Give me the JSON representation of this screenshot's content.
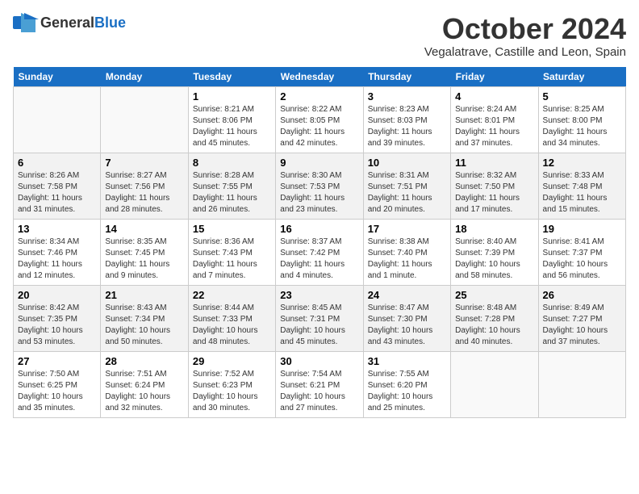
{
  "header": {
    "logo_general": "General",
    "logo_blue": "Blue",
    "month_title": "October 2024",
    "location": "Vegalatrave, Castille and Leon, Spain"
  },
  "weekdays": [
    "Sunday",
    "Monday",
    "Tuesday",
    "Wednesday",
    "Thursday",
    "Friday",
    "Saturday"
  ],
  "weeks": [
    [
      {
        "day": "",
        "sunrise": "",
        "sunset": "",
        "daylight": ""
      },
      {
        "day": "",
        "sunrise": "",
        "sunset": "",
        "daylight": ""
      },
      {
        "day": "1",
        "sunrise": "Sunrise: 8:21 AM",
        "sunset": "Sunset: 8:06 PM",
        "daylight": "Daylight: 11 hours and 45 minutes."
      },
      {
        "day": "2",
        "sunrise": "Sunrise: 8:22 AM",
        "sunset": "Sunset: 8:05 PM",
        "daylight": "Daylight: 11 hours and 42 minutes."
      },
      {
        "day": "3",
        "sunrise": "Sunrise: 8:23 AM",
        "sunset": "Sunset: 8:03 PM",
        "daylight": "Daylight: 11 hours and 39 minutes."
      },
      {
        "day": "4",
        "sunrise": "Sunrise: 8:24 AM",
        "sunset": "Sunset: 8:01 PM",
        "daylight": "Daylight: 11 hours and 37 minutes."
      },
      {
        "day": "5",
        "sunrise": "Sunrise: 8:25 AM",
        "sunset": "Sunset: 8:00 PM",
        "daylight": "Daylight: 11 hours and 34 minutes."
      }
    ],
    [
      {
        "day": "6",
        "sunrise": "Sunrise: 8:26 AM",
        "sunset": "Sunset: 7:58 PM",
        "daylight": "Daylight: 11 hours and 31 minutes."
      },
      {
        "day": "7",
        "sunrise": "Sunrise: 8:27 AM",
        "sunset": "Sunset: 7:56 PM",
        "daylight": "Daylight: 11 hours and 28 minutes."
      },
      {
        "day": "8",
        "sunrise": "Sunrise: 8:28 AM",
        "sunset": "Sunset: 7:55 PM",
        "daylight": "Daylight: 11 hours and 26 minutes."
      },
      {
        "day": "9",
        "sunrise": "Sunrise: 8:30 AM",
        "sunset": "Sunset: 7:53 PM",
        "daylight": "Daylight: 11 hours and 23 minutes."
      },
      {
        "day": "10",
        "sunrise": "Sunrise: 8:31 AM",
        "sunset": "Sunset: 7:51 PM",
        "daylight": "Daylight: 11 hours and 20 minutes."
      },
      {
        "day": "11",
        "sunrise": "Sunrise: 8:32 AM",
        "sunset": "Sunset: 7:50 PM",
        "daylight": "Daylight: 11 hours and 17 minutes."
      },
      {
        "day": "12",
        "sunrise": "Sunrise: 8:33 AM",
        "sunset": "Sunset: 7:48 PM",
        "daylight": "Daylight: 11 hours and 15 minutes."
      }
    ],
    [
      {
        "day": "13",
        "sunrise": "Sunrise: 8:34 AM",
        "sunset": "Sunset: 7:46 PM",
        "daylight": "Daylight: 11 hours and 12 minutes."
      },
      {
        "day": "14",
        "sunrise": "Sunrise: 8:35 AM",
        "sunset": "Sunset: 7:45 PM",
        "daylight": "Daylight: 11 hours and 9 minutes."
      },
      {
        "day": "15",
        "sunrise": "Sunrise: 8:36 AM",
        "sunset": "Sunset: 7:43 PM",
        "daylight": "Daylight: 11 hours and 7 minutes."
      },
      {
        "day": "16",
        "sunrise": "Sunrise: 8:37 AM",
        "sunset": "Sunset: 7:42 PM",
        "daylight": "Daylight: 11 hours and 4 minutes."
      },
      {
        "day": "17",
        "sunrise": "Sunrise: 8:38 AM",
        "sunset": "Sunset: 7:40 PM",
        "daylight": "Daylight: 11 hours and 1 minute."
      },
      {
        "day": "18",
        "sunrise": "Sunrise: 8:40 AM",
        "sunset": "Sunset: 7:39 PM",
        "daylight": "Daylight: 10 hours and 58 minutes."
      },
      {
        "day": "19",
        "sunrise": "Sunrise: 8:41 AM",
        "sunset": "Sunset: 7:37 PM",
        "daylight": "Daylight: 10 hours and 56 minutes."
      }
    ],
    [
      {
        "day": "20",
        "sunrise": "Sunrise: 8:42 AM",
        "sunset": "Sunset: 7:35 PM",
        "daylight": "Daylight: 10 hours and 53 minutes."
      },
      {
        "day": "21",
        "sunrise": "Sunrise: 8:43 AM",
        "sunset": "Sunset: 7:34 PM",
        "daylight": "Daylight: 10 hours and 50 minutes."
      },
      {
        "day": "22",
        "sunrise": "Sunrise: 8:44 AM",
        "sunset": "Sunset: 7:33 PM",
        "daylight": "Daylight: 10 hours and 48 minutes."
      },
      {
        "day": "23",
        "sunrise": "Sunrise: 8:45 AM",
        "sunset": "Sunset: 7:31 PM",
        "daylight": "Daylight: 10 hours and 45 minutes."
      },
      {
        "day": "24",
        "sunrise": "Sunrise: 8:47 AM",
        "sunset": "Sunset: 7:30 PM",
        "daylight": "Daylight: 10 hours and 43 minutes."
      },
      {
        "day": "25",
        "sunrise": "Sunrise: 8:48 AM",
        "sunset": "Sunset: 7:28 PM",
        "daylight": "Daylight: 10 hours and 40 minutes."
      },
      {
        "day": "26",
        "sunrise": "Sunrise: 8:49 AM",
        "sunset": "Sunset: 7:27 PM",
        "daylight": "Daylight: 10 hours and 37 minutes."
      }
    ],
    [
      {
        "day": "27",
        "sunrise": "Sunrise: 7:50 AM",
        "sunset": "Sunset: 6:25 PM",
        "daylight": "Daylight: 10 hours and 35 minutes."
      },
      {
        "day": "28",
        "sunrise": "Sunrise: 7:51 AM",
        "sunset": "Sunset: 6:24 PM",
        "daylight": "Daylight: 10 hours and 32 minutes."
      },
      {
        "day": "29",
        "sunrise": "Sunrise: 7:52 AM",
        "sunset": "Sunset: 6:23 PM",
        "daylight": "Daylight: 10 hours and 30 minutes."
      },
      {
        "day": "30",
        "sunrise": "Sunrise: 7:54 AM",
        "sunset": "Sunset: 6:21 PM",
        "daylight": "Daylight: 10 hours and 27 minutes."
      },
      {
        "day": "31",
        "sunrise": "Sunrise: 7:55 AM",
        "sunset": "Sunset: 6:20 PM",
        "daylight": "Daylight: 10 hours and 25 minutes."
      },
      {
        "day": "",
        "sunrise": "",
        "sunset": "",
        "daylight": ""
      },
      {
        "day": "",
        "sunrise": "",
        "sunset": "",
        "daylight": ""
      }
    ]
  ]
}
